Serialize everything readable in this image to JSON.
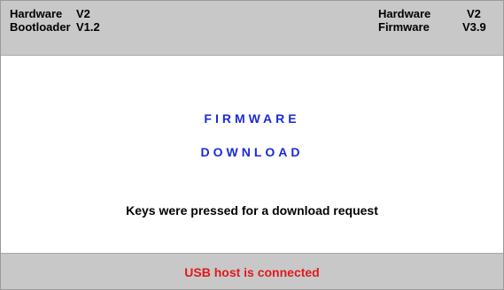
{
  "header": {
    "left": [
      {
        "label": "Hardware",
        "value": "V2"
      },
      {
        "label": "Bootloader",
        "value": "V1.2"
      }
    ],
    "right": [
      {
        "label": "Hardware",
        "value": "V2"
      },
      {
        "label": "Firmware",
        "value": "V3.9"
      }
    ]
  },
  "main": {
    "title_line1": "FIRMWARE",
    "title_line2": "DOWNLOAD",
    "message": "Keys were pressed for a download request"
  },
  "footer": {
    "status": "USB host is connected"
  },
  "colors": {
    "bar_background": "#c8c8c8",
    "title_text": "#1a2bd6",
    "status_text": "#e0191e"
  }
}
